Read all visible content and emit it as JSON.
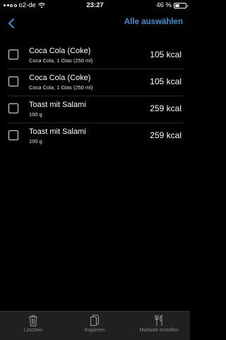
{
  "status_bar": {
    "carrier": "o2-de",
    "time": "23:27",
    "battery_text": "46 %",
    "battery_level": 0.46
  },
  "nav": {
    "back_icon": "chevron-left-icon",
    "select_all_label": "Alle auswählen",
    "accent_color": "#3a8fd9"
  },
  "items": [
    {
      "title": "Coca Cola (Coke)",
      "subtitle": "Coca Cola, 1 Glas (250 ml)",
      "kcal": "105 kcal",
      "checked": false
    },
    {
      "title": "Coca Cola (Coke)",
      "subtitle": "Coca Cola, 1 Glas (250 ml)",
      "kcal": "105 kcal",
      "checked": false
    },
    {
      "title": "Toast mit Salami",
      "subtitle": "100 g",
      "kcal": "259 kcal",
      "checked": false
    },
    {
      "title": "Toast mit Salami",
      "subtitle": "100 g",
      "kcal": "259 kcal",
      "checked": false
    }
  ],
  "bottom_bar": {
    "delete_label": "Löschen",
    "copy_label": "Kopieren",
    "create_meal_label": "Mahlzeit erstellen",
    "delete_icon": "trash-icon",
    "copy_icon": "copy-icon",
    "create_meal_icon": "fork-knife-icon"
  }
}
